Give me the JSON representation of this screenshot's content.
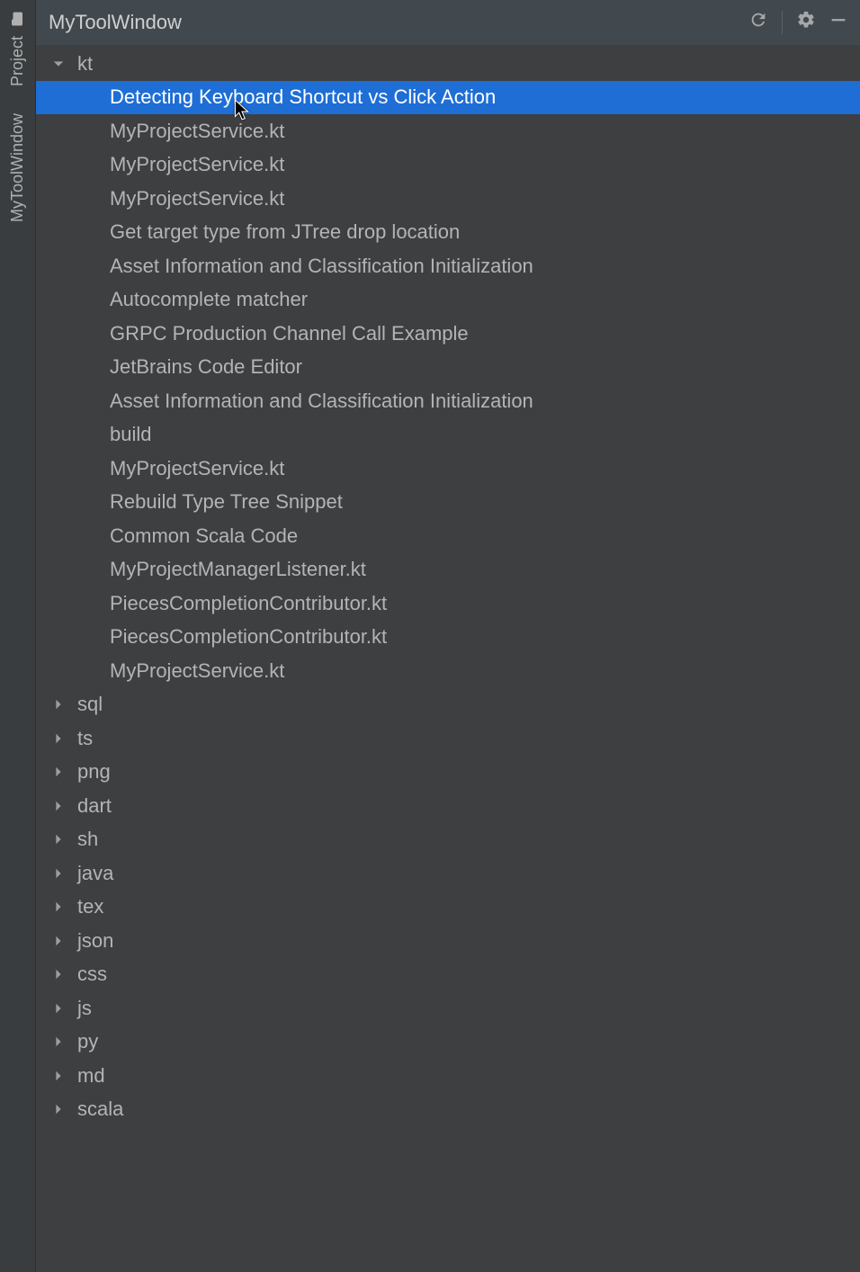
{
  "rail": {
    "tabs": [
      {
        "label": "Project"
      },
      {
        "label": "MyToolWindow"
      }
    ]
  },
  "header": {
    "title": "MyToolWindow"
  },
  "tree": {
    "root": {
      "label": "kt",
      "expanded": true,
      "children": [
        "Detecting Keyboard Shortcut vs Click Action",
        "MyProjectService.kt",
        "MyProjectService.kt",
        "MyProjectService.kt",
        "Get target type from JTree drop location",
        "Asset Information and Classification Initialization",
        "Autocomplete matcher",
        "GRPC Production Channel Call Example",
        "JetBrains Code Editor",
        "Asset Information and Classification Initialization",
        "build",
        "MyProjectService.kt",
        "Rebuild Type Tree Snippet",
        "Common Scala Code",
        "MyProjectManagerListener.kt",
        "PiecesCompletionContributor.kt",
        "PiecesCompletionContributor.kt",
        "MyProjectService.kt"
      ],
      "selectedIndex": 0
    },
    "folders": [
      "sql",
      "ts",
      "png",
      "dart",
      "sh",
      "java",
      "tex",
      "json",
      "css",
      "js",
      "py",
      "md",
      "scala"
    ]
  }
}
